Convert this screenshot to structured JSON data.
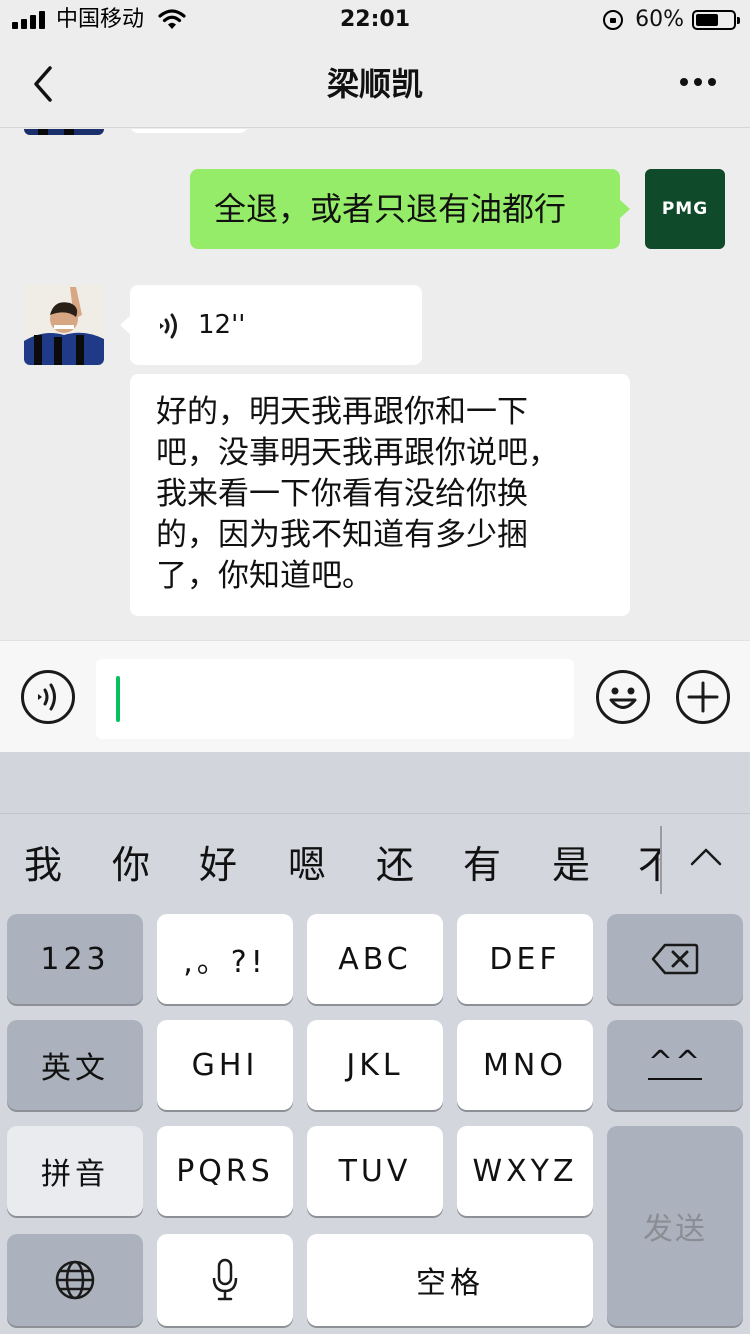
{
  "status_bar": {
    "carrier": "中国移动",
    "time": "22:01",
    "battery": "60%",
    "battery_level": 0.6
  },
  "nav": {
    "title": "梁顺凯"
  },
  "messages": {
    "sent_text": "全退，或者只退有油都行",
    "my_avatar_text": "PMG",
    "voice_duration": "12''",
    "received_text": "好的，明天我再跟你和一下\n吧，没事明天我再跟你说吧，\n我来看一下你看有没给你换\n的，因为我不知道有多少捆\n了，你知道吧。"
  },
  "input": {
    "value": ""
  },
  "keyboard": {
    "candidates": [
      "我",
      "你",
      "好",
      "嗯",
      "还",
      "有",
      "是",
      "不"
    ],
    "keys": {
      "k123": "123",
      "punct": ",。?!",
      "abc": "ABC",
      "def": "DEF",
      "english": "英文",
      "ghi": "GHI",
      "jkl": "JKL",
      "mno": "MNO",
      "emoticon": "^^",
      "pinyin": "拼音",
      "pqrs": "PQRS",
      "tuv": "TUV",
      "wxyz": "WXYZ",
      "send": "发送",
      "space": "空格"
    }
  },
  "colors": {
    "sent_bubble": "#95ec69",
    "caret": "#07c160",
    "background": "#ededed"
  }
}
